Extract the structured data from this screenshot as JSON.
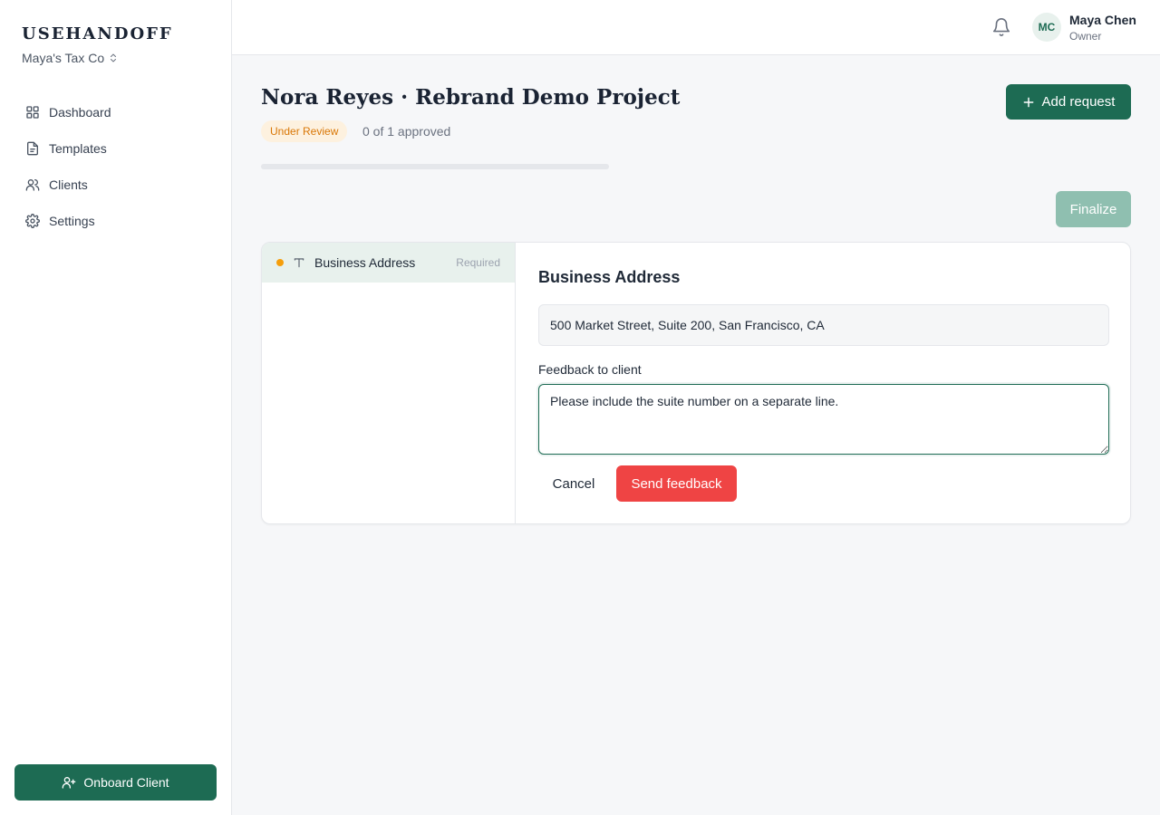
{
  "brand": {
    "name": "USEHANDOFF",
    "org": "Maya's Tax Co"
  },
  "sidebar": {
    "items": [
      {
        "label": "Dashboard",
        "icon": "grid-icon"
      },
      {
        "label": "Templates",
        "icon": "file-text-icon"
      },
      {
        "label": "Clients",
        "icon": "users-icon"
      },
      {
        "label": "Settings",
        "icon": "gear-icon"
      }
    ],
    "onboard_label": "Onboard Client"
  },
  "header": {
    "user": {
      "initials": "MC",
      "name": "Maya Chen",
      "role": "Owner"
    }
  },
  "main": {
    "title": "Nora Reyes · Rebrand Demo Project",
    "status": "Under Review",
    "approved_text": "0 of 1 approved",
    "progress": 0,
    "add_request_label": "Add request",
    "finalize_label": "Finalize"
  },
  "requests": [
    {
      "label": "Business Address",
      "tag": "Required",
      "status_color": "#f59e0b"
    }
  ],
  "detail": {
    "title": "Business Address",
    "answer": "500 Market Street, Suite 200, San Francisco, CA",
    "feedback_label": "Feedback to client",
    "feedback_value": "Please include the suite number on a separate line.",
    "cancel_label": "Cancel",
    "send_label": "Send feedback"
  },
  "colors": {
    "brand_green": "#1d6b53",
    "danger": "#ef4444",
    "status_amber": "#d97706"
  }
}
